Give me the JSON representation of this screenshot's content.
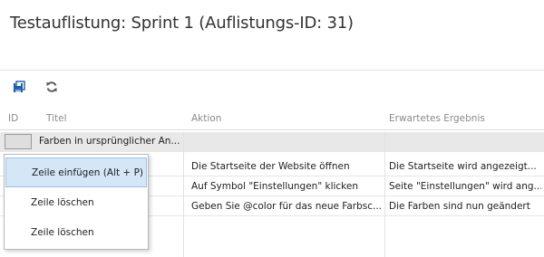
{
  "page": {
    "title": "Testauflistung: Sprint 1 (Auflistungs-ID: 31)"
  },
  "toolbar": {
    "save_icon": "save-icon",
    "refresh_icon": "refresh-icon"
  },
  "grid": {
    "columns": [
      "ID",
      "Titel",
      "Aktion",
      "Erwartetes Ergebnis"
    ],
    "selected_row_title": "Farben in ursprünglicher An...",
    "rows": [
      {
        "action": "Die Startseite der Website öffnen",
        "expected": "Die Startseite wird angezeigt..."
      },
      {
        "action": "Auf Symbol \"Einstellungen\" klicken",
        "expected": "Seite \"Einstellungen\" wird ang..."
      },
      {
        "action": "Geben Sie @color für das neue Farbsc...",
        "expected": "Die Farben sind nun geändert"
      }
    ]
  },
  "context_menu": {
    "items": [
      {
        "label": "Zeile einfügen (Alt + P)",
        "highlighted": true
      },
      {
        "label": "Zeile löschen",
        "highlighted": false
      },
      {
        "label": "Zeile löschen",
        "highlighted": false
      }
    ]
  },
  "colors": {
    "accent": "#1e5fa8",
    "selection": "#e8e8e8",
    "menu_highlight": "#d5e6f6"
  }
}
